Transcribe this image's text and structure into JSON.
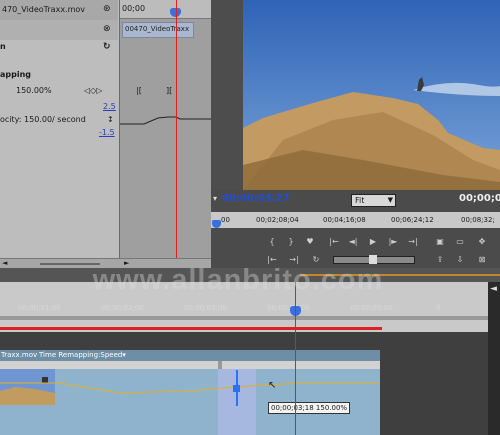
{
  "effect_controls": {
    "clip_tab": "470_VideoTraxx.mov",
    "timecode": "00;00",
    "clip_name": "00470_VideoTraxx",
    "row1_label": "n",
    "row2_label": "apping",
    "speed_value": "150.00%",
    "velocity_label": "ocity: 150.00/ second",
    "graph_max": "2.5",
    "graph_min": "-1.5"
  },
  "program_monitor": {
    "timecode": "00;00;03;27",
    "fit_option": "Fit",
    "right_timecode": "00;00;0",
    "ruler_ticks": [
      "00",
      "00;02;08;04",
      "00;04;16;08",
      "00;06;24;12",
      "00;08;32;"
    ]
  },
  "timeline": {
    "ruler_ticks": [
      "00;00;01;00",
      "00;00;02;00",
      "00;00;03;00",
      "00;00;04;00",
      "00;00;05;00",
      "0"
    ],
    "clip_label": "Traxx.mov",
    "remap_label": "Time Remapping:Speed▾",
    "tooltip": "00;00;03;18 150.00%"
  },
  "watermark": "www.allanbrito.com",
  "colors": {
    "accent": "#2d6fff",
    "playhead": "#e02020",
    "tc_blue": "#1f4fd8"
  }
}
